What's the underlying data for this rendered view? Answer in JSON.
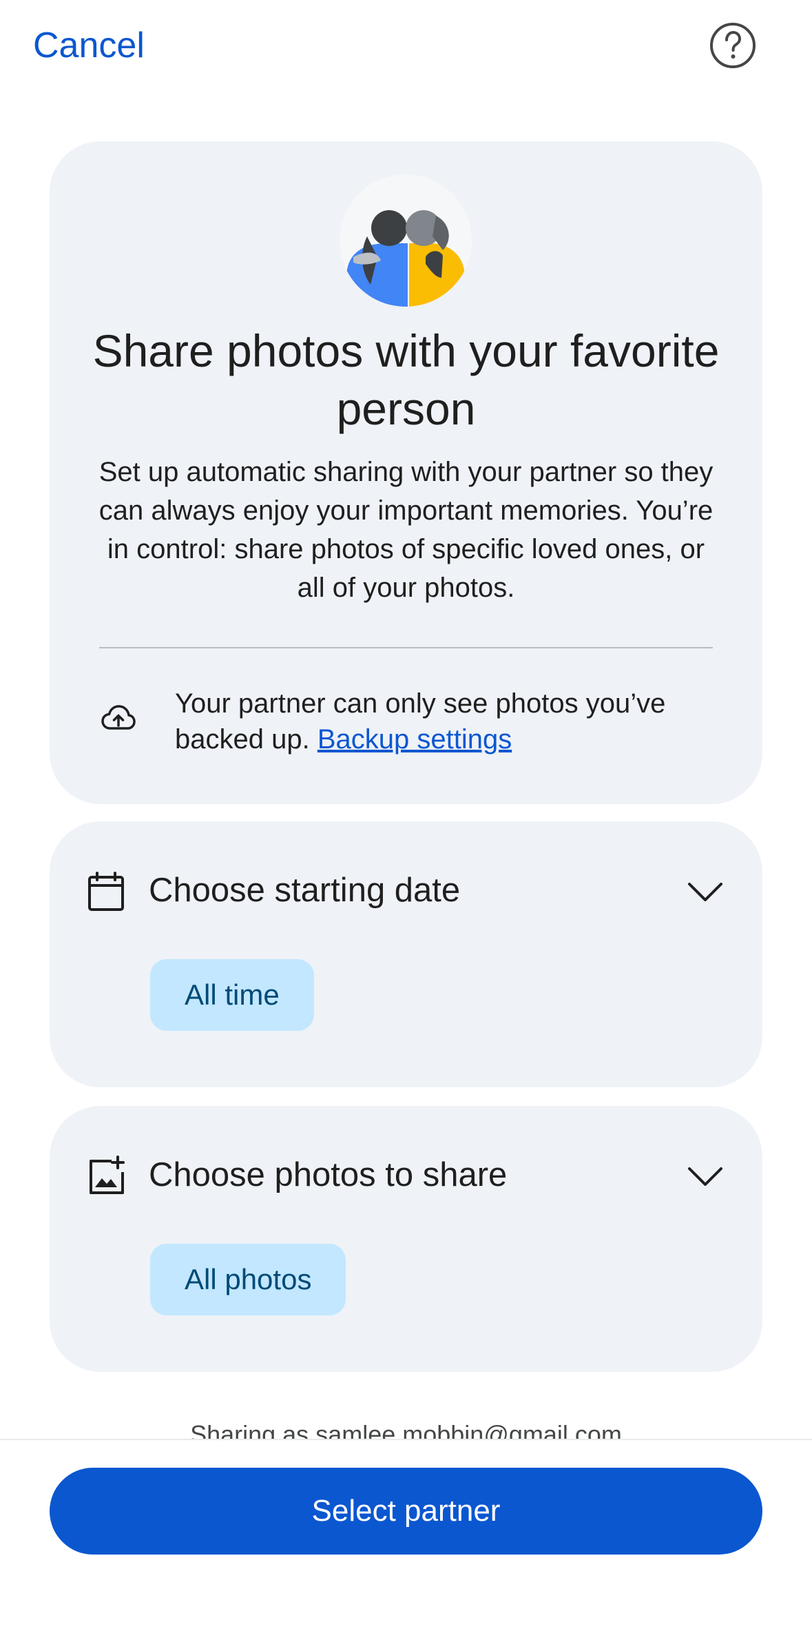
{
  "header": {
    "cancel_label": "Cancel",
    "help_icon": "help-circle-icon"
  },
  "hero": {
    "illustration": "partners-hugging-illustration",
    "title": "Share photos with your favorite person",
    "description": "Set up automatic sharing with your partner so they can always enjoy your important memories. You’re in control: share photos of specific loved ones, or all of your photos.",
    "backup_icon": "cloud-upload-icon",
    "backup_text": "Your partner can only see photos you’ve backed up.",
    "backup_link": "Backup settings"
  },
  "options": {
    "date": {
      "icon": "calendar-icon",
      "title": "Choose starting date",
      "selected": "All time",
      "chevron": "chevron-down-icon"
    },
    "photos": {
      "icon": "add-photo-icon",
      "title": "Choose photos to share",
      "selected": "All photos",
      "chevron": "chevron-down-icon"
    }
  },
  "footer": {
    "sharing_as": "Sharing as samlee.mobbin@gmail.com",
    "primary_button": "Select partner"
  },
  "colors": {
    "accent": "#0b57d0",
    "card_bg": "#eff2f7",
    "chip_bg": "#c2e7ff",
    "chip_text": "#004a77"
  }
}
